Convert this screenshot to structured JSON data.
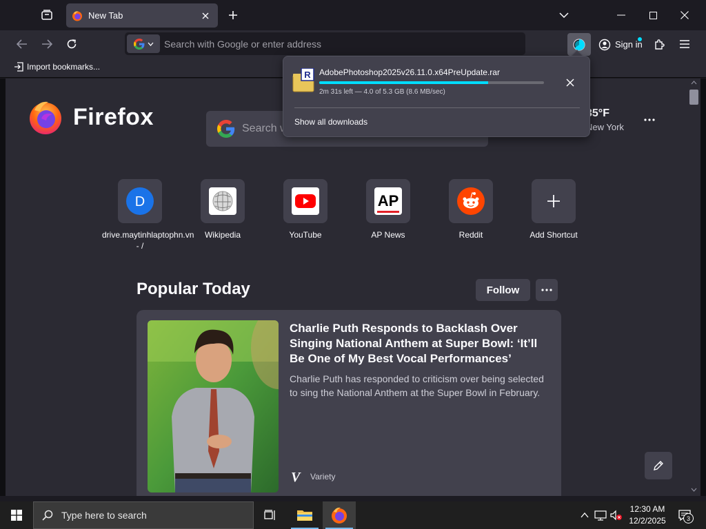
{
  "browser": {
    "tab": {
      "title": "New Tab"
    },
    "urlbar": {
      "placeholder": "Search with Google or enter address"
    },
    "account": {
      "signin_label": "Sign in"
    },
    "bookmarks": {
      "import_label": "Import bookmarks..."
    }
  },
  "newtab": {
    "brand": "Firefox",
    "search_placeholder": "Search w",
    "weather": {
      "temp": "35°F",
      "location": "New York"
    },
    "shortcuts": [
      {
        "label": "drive.maytinhlaptophn.vn - /",
        "letter": "D",
        "icon": "drive-letter-icon"
      },
      {
        "label": "Wikipedia",
        "icon": "wikipedia-icon"
      },
      {
        "label": "YouTube",
        "icon": "youtube-icon"
      },
      {
        "label": "AP News",
        "letter": "AP",
        "icon": "ap-news-icon"
      },
      {
        "label": "Reddit",
        "icon": "reddit-icon"
      },
      {
        "label": "Add Shortcut",
        "icon": "plus-icon"
      }
    ],
    "popular": {
      "title": "Popular Today",
      "follow_label": "Follow",
      "story": {
        "headline": "Charlie Puth Responds to Backlash Over Singing National Anthem at Super Bowl: ‘It’ll Be One of My Best Vocal Performances’",
        "excerpt": "Charlie Puth has responded to criticism over being selected to sing the National Anthem at the Super Bowl in February.",
        "source": "Variety",
        "source_logo": "V"
      }
    }
  },
  "downloads": {
    "file_name": "AdobePhotoshop2025v26.11.0.x64PreUpdate.rar",
    "status": "2m 31s left — 4.0 of 5.3 GB (8.6 MB/sec)",
    "progress": 0.75,
    "show_all_label": "Show all downloads",
    "file_badge": "R"
  },
  "taskbar": {
    "search_placeholder": "Type here to search",
    "time": "12:30 AM",
    "date": "12/2/2025",
    "notification_count": "3"
  },
  "colors": {
    "accent": "#00ddff",
    "tab_bg": "#42414d",
    "content_bg": "#2b2a33",
    "youtube_red": "#ff0000",
    "reddit_orange": "#ff4500",
    "drive_blue": "#1a73e8"
  }
}
